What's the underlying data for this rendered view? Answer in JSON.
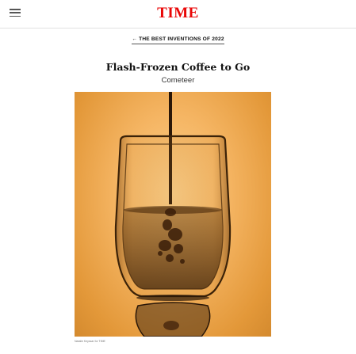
{
  "header": {
    "logo_text": "TIME",
    "menu_icon": "hamburger-menu-icon",
    "brand_color": "#e90606"
  },
  "breadcrumb": {
    "label": "← THE BEST INVENTIONS OF 2022"
  },
  "article": {
    "title": "Flash-Frozen Coffee to Go",
    "company": "Cometeer"
  },
  "image": {
    "subject": "coffee-pour-glass-photo",
    "credit": "Natalie Keyssar for TIME",
    "background_color": "#f5b563"
  }
}
